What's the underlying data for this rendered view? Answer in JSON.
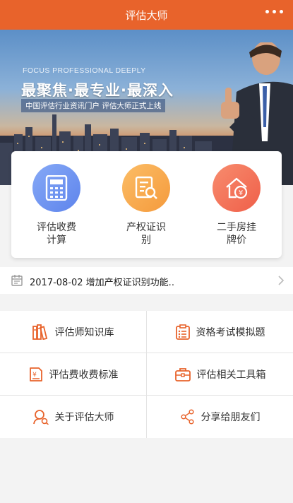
{
  "header": {
    "title": "评估大师"
  },
  "banner": {
    "english_tagline": "FOCUS PROFESSIONAL DEEPLY",
    "headline": "最聚焦·最专业·最深入",
    "subline": "中国评估行业资讯门户 评估大师正式上线"
  },
  "quick_actions": [
    {
      "label": "评估收费计算",
      "icon": "calculator-icon",
      "color": "#6f95f2"
    },
    {
      "label": "产权证识别",
      "icon": "document-search-icon",
      "color": "#f8a94e"
    },
    {
      "label": "二手房挂牌价",
      "icon": "house-price-icon",
      "color": "#f3715a"
    }
  ],
  "news": {
    "icon": "calendar-icon",
    "text": "2017-08-02 增加产权证识别功能.."
  },
  "menu": [
    {
      "label": "评估师知识库",
      "icon": "books-icon"
    },
    {
      "label": "资格考试模拟题",
      "icon": "exam-list-icon"
    },
    {
      "label": "评估费收费标准",
      "icon": "fee-standard-icon"
    },
    {
      "label": "评估相关工具箱",
      "icon": "toolbox-icon"
    },
    {
      "label": "关于评估大师",
      "icon": "about-user-icon"
    },
    {
      "label": "分享给朋友们",
      "icon": "share-icon"
    }
  ],
  "colors": {
    "accent": "#e8632b",
    "background": "#f3f3f3"
  }
}
